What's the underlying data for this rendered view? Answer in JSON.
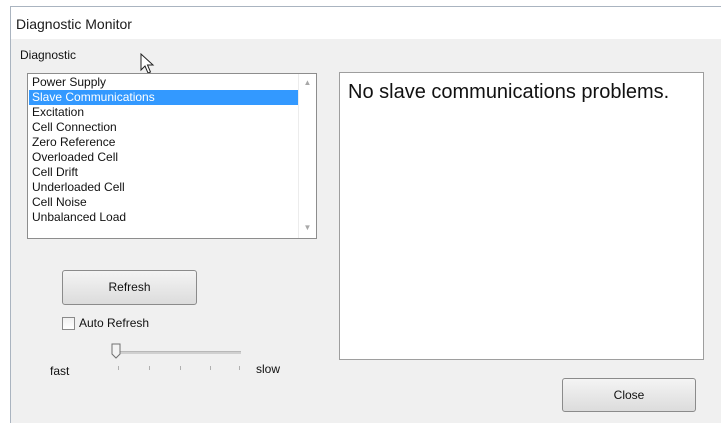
{
  "window": {
    "title": "Diagnostic Monitor"
  },
  "diagnostic": {
    "group_label": "Diagnostic",
    "items": [
      {
        "label": "Power Supply",
        "selected": false
      },
      {
        "label": "Slave Communications",
        "selected": true
      },
      {
        "label": "Excitation",
        "selected": false
      },
      {
        "label": "Cell Connection",
        "selected": false
      },
      {
        "label": "Zero Reference",
        "selected": false
      },
      {
        "label": "Overloaded Cell",
        "selected": false
      },
      {
        "label": "Cell Drift",
        "selected": false
      },
      {
        "label": "Underloaded Cell",
        "selected": false
      },
      {
        "label": "Cell Noise",
        "selected": false
      },
      {
        "label": "Unbalanced Load",
        "selected": false
      }
    ]
  },
  "message": {
    "text": "No slave communications problems."
  },
  "controls": {
    "refresh_label": "Refresh",
    "auto_refresh_label": "Auto Refresh",
    "auto_refresh_checked": false,
    "speed_fast_label": "fast",
    "speed_slow_label": "slow",
    "speed_value": 0,
    "close_label": "Close"
  },
  "colors": {
    "selection": "#3399ff",
    "window_bg": "#f0f0f0"
  },
  "icons": {
    "cursor": "mouse-pointer-icon",
    "scroll_up": "chevron-up-icon",
    "scroll_down": "chevron-down-icon"
  }
}
